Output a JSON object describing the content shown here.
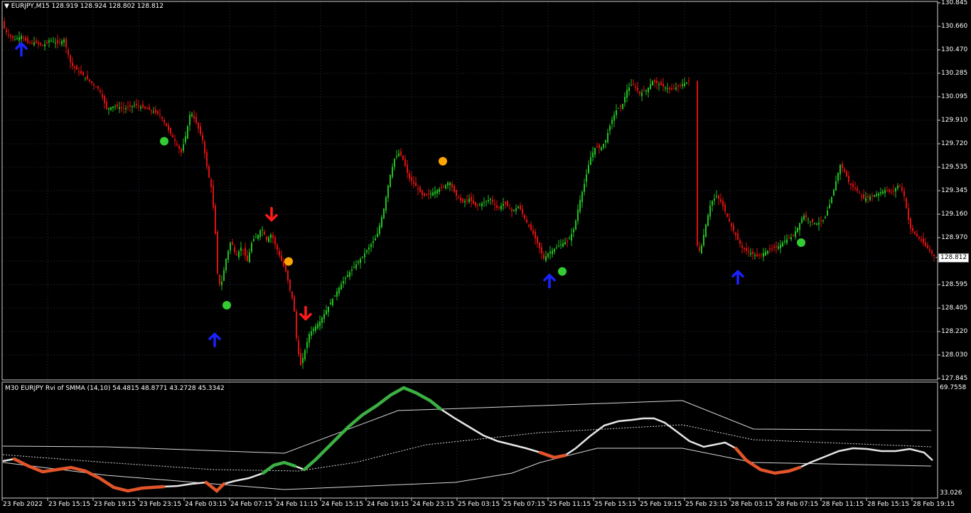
{
  "header": {
    "symbol_tf": "EURJPY,M15",
    "ohlc": "128.919 128.924 128.802 128.812"
  },
  "indicator": {
    "title": "M30 EURJPY Rvi of SMMA (14,10) 54.4815 48.8771 43.2728 45.3342",
    "scale_top": "69.7558",
    "scale_bottom": "33.026"
  },
  "price_scale": [
    "130.845",
    "130.660",
    "130.470",
    "130.285",
    "130.095",
    "129.910",
    "129.720",
    "129.535",
    "129.345",
    "129.160",
    "128.970",
    "128.785",
    "128.595",
    "128.405",
    "128.220",
    "128.030",
    "127.845"
  ],
  "current_price": "128.812",
  "time_labels": [
    "23 Feb 2022",
    "23 Feb 15:15",
    "23 Feb 19:15",
    "23 Feb 23:15",
    "24 Feb 03:15",
    "24 Feb 07:15",
    "24 Feb 11:15",
    "24 Feb 15:15",
    "24 Feb 19:15",
    "24 Feb 23:15",
    "25 Feb 03:15",
    "25 Feb 07:15",
    "25 Feb 11:15",
    "25 Feb 15:15",
    "25 Feb 19:15",
    "25 Feb 23:15",
    "28 Feb 03:15",
    "28 Feb 07:15",
    "28 Feb 11:15",
    "28 Feb 15:15",
    "28 Feb 19:15"
  ],
  "colors": {
    "background": "#000000",
    "grid": "#2a2f4a",
    "bull_candle": "#22c022",
    "bear_candle": "#dd1111",
    "buy_arrow": "#1a22ff",
    "sell_arrow": "#ff1a1a",
    "green_dot": "#33cc33",
    "orange_dot": "#ffa500",
    "rvi_line": "#e6e6e6",
    "rvi_up": "#3cb043",
    "rvi_down": "#e2542a",
    "bands": "#d8d8d8"
  },
  "chart_data": {
    "type": "candlestick",
    "symbol": "EURJPY",
    "timeframe": "M15",
    "ylim": [
      127.845,
      130.845
    ],
    "close_path": [
      [
        0,
        130.7
      ],
      [
        10,
        130.6
      ],
      [
        20,
        130.55
      ],
      [
        30,
        130.58
      ],
      [
        40,
        130.52
      ],
      [
        50,
        130.53
      ],
      [
        60,
        130.5
      ],
      [
        70,
        130.55
      ],
      [
        80,
        130.52
      ],
      [
        90,
        130.55
      ],
      [
        95,
        130.45
      ],
      [
        100,
        130.35
      ],
      [
        110,
        130.3
      ],
      [
        120,
        130.25
      ],
      [
        130,
        130.2
      ],
      [
        140,
        130.15
      ],
      [
        150,
        130.0
      ],
      [
        160,
        130.02
      ],
      [
        175,
        130.0
      ],
      [
        190,
        130.03
      ],
      [
        205,
        130.0
      ],
      [
        215,
        129.98
      ],
      [
        225,
        129.95
      ],
      [
        235,
        129.85
      ],
      [
        245,
        129.75
      ],
      [
        255,
        129.65
      ],
      [
        262,
        129.8
      ],
      [
        268,
        129.98
      ],
      [
        275,
        129.9
      ],
      [
        285,
        129.75
      ],
      [
        292,
        129.5
      ],
      [
        298,
        129.35
      ],
      [
        303,
        129.0
      ],
      [
        307,
        128.58
      ],
      [
        312,
        128.62
      ],
      [
        318,
        128.8
      ],
      [
        325,
        128.95
      ],
      [
        332,
        128.82
      ],
      [
        340,
        128.9
      ],
      [
        348,
        128.78
      ],
      [
        355,
        128.95
      ],
      [
        362,
        128.98
      ],
      [
        368,
        129.05
      ],
      [
        375,
        128.95
      ],
      [
        382,
        129.0
      ],
      [
        388,
        128.9
      ],
      [
        395,
        128.8
      ],
      [
        402,
        128.7
      ],
      [
        408,
        128.55
      ],
      [
        413,
        128.45
      ],
      [
        418,
        128.1
      ],
      [
        423,
        127.95
      ],
      [
        428,
        128.05
      ],
      [
        435,
        128.2
      ],
      [
        442,
        128.25
      ],
      [
        450,
        128.3
      ],
      [
        460,
        128.4
      ],
      [
        470,
        128.5
      ],
      [
        480,
        128.6
      ],
      [
        490,
        128.68
      ],
      [
        500,
        128.75
      ],
      [
        510,
        128.82
      ],
      [
        520,
        128.9
      ],
      [
        530,
        128.98
      ],
      [
        540,
        129.2
      ],
      [
        548,
        129.45
      ],
      [
        555,
        129.6
      ],
      [
        562,
        129.65
      ],
      [
        568,
        129.58
      ],
      [
        575,
        129.45
      ],
      [
        585,
        129.38
      ],
      [
        595,
        129.3
      ],
      [
        605,
        129.32
      ],
      [
        615,
        129.35
      ],
      [
        625,
        129.38
      ],
      [
        632,
        129.42
      ],
      [
        640,
        129.32
      ],
      [
        650,
        129.25
      ],
      [
        660,
        129.28
      ],
      [
        670,
        129.22
      ],
      [
        680,
        129.25
      ],
      [
        690,
        129.28
      ],
      [
        700,
        129.2
      ],
      [
        710,
        129.25
      ],
      [
        720,
        129.18
      ],
      [
        730,
        129.22
      ],
      [
        740,
        129.1
      ],
      [
        750,
        129.0
      ],
      [
        758,
        128.9
      ],
      [
        765,
        128.8
      ],
      [
        772,
        128.85
      ],
      [
        780,
        128.88
      ],
      [
        790,
        128.92
      ],
      [
        800,
        128.95
      ],
      [
        808,
        129.05
      ],
      [
        815,
        129.25
      ],
      [
        822,
        129.4
      ],
      [
        830,
        129.6
      ],
      [
        838,
        129.7
      ],
      [
        845,
        129.68
      ],
      [
        852,
        129.75
      ],
      [
        860,
        129.9
      ],
      [
        868,
        130.0
      ],
      [
        875,
        130.02
      ],
      [
        882,
        130.15
      ],
      [
        890,
        130.2
      ],
      [
        900,
        130.12
      ],
      [
        910,
        130.15
      ],
      [
        918,
        130.22
      ],
      [
        925,
        130.2
      ],
      [
        935,
        130.17
      ],
      [
        945,
        130.15
      ],
      [
        955,
        130.18
      ],
      [
        962,
        130.2
      ],
      [
        970,
        130.22
      ],
      [
        978,
        128.95
      ],
      [
        985,
        128.85
      ],
      [
        992,
        129.05
      ],
      [
        1000,
        129.25
      ],
      [
        1008,
        129.3
      ],
      [
        1015,
        129.25
      ],
      [
        1022,
        129.15
      ],
      [
        1030,
        129.05
      ],
      [
        1038,
        128.95
      ],
      [
        1045,
        128.88
      ],
      [
        1055,
        128.85
      ],
      [
        1065,
        128.82
      ],
      [
        1075,
        128.85
      ],
      [
        1085,
        128.88
      ],
      [
        1095,
        128.9
      ],
      [
        1105,
        128.95
      ],
      [
        1115,
        128.98
      ],
      [
        1122,
        129.05
      ],
      [
        1130,
        129.15
      ],
      [
        1140,
        129.1
      ],
      [
        1150,
        129.08
      ],
      [
        1160,
        129.12
      ],
      [
        1168,
        129.25
      ],
      [
        1175,
        129.4
      ],
      [
        1182,
        129.55
      ],
      [
        1188,
        129.5
      ],
      [
        1195,
        129.4
      ],
      [
        1205,
        129.35
      ],
      [
        1215,
        129.28
      ],
      [
        1225,
        129.3
      ],
      [
        1235,
        129.32
      ],
      [
        1245,
        129.35
      ],
      [
        1255,
        129.33
      ],
      [
        1265,
        129.4
      ],
      [
        1272,
        129.3
      ],
      [
        1280,
        129.05
      ],
      [
        1290,
        128.98
      ],
      [
        1300,
        128.92
      ],
      [
        1310,
        128.85
      ],
      [
        1316,
        128.81
      ]
    ],
    "buy_signals": [
      [
        30,
        130.47
      ],
      [
        302,
        128.15
      ],
      [
        773,
        128.62
      ],
      [
        1038,
        128.65
      ]
    ],
    "sell_signals": [
      [
        382,
        129.16
      ],
      [
        430,
        128.37
      ]
    ],
    "green_dots": [
      [
        231,
        129.74
      ],
      [
        319,
        128.43
      ],
      [
        791,
        128.7
      ],
      [
        1127,
        128.93
      ]
    ],
    "orange_dots": [
      [
        406,
        128.78
      ],
      [
        623,
        129.58
      ]
    ]
  }
}
